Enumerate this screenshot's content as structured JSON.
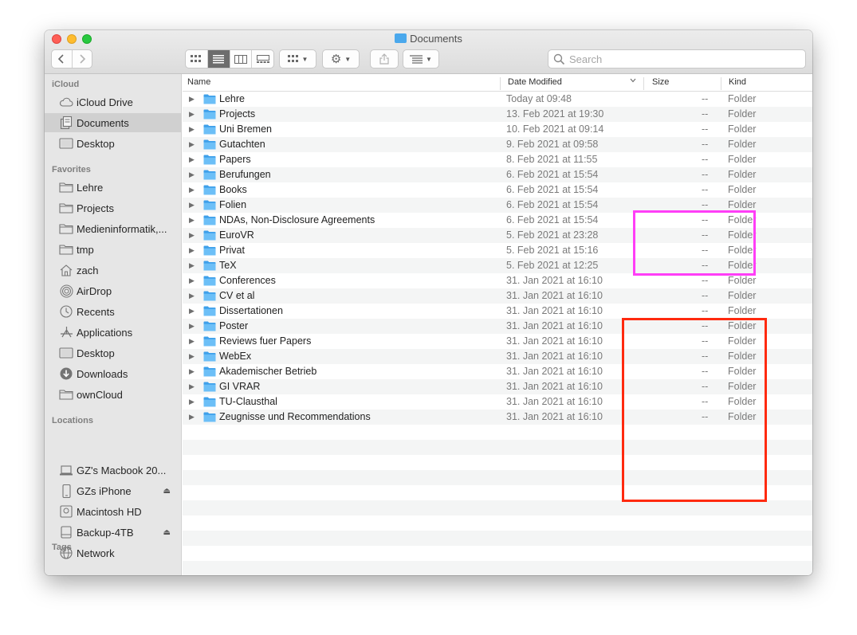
{
  "window": {
    "title": "Documents"
  },
  "toolbar": {
    "back_icon": "chevron-left",
    "forward_icon": "chevron-right",
    "search_placeholder": "Search"
  },
  "sidebar": {
    "sections": [
      {
        "title": "iCloud",
        "items": [
          {
            "label": "iCloud Drive",
            "icon": "cloud-icon"
          },
          {
            "label": "Documents",
            "icon": "document-icon",
            "selected": true
          },
          {
            "label": "Desktop",
            "icon": "desktop-icon"
          }
        ]
      },
      {
        "title": "Favorites",
        "items": [
          {
            "label": "Lehre",
            "icon": "folder-icon"
          },
          {
            "label": "Projects",
            "icon": "folder-icon"
          },
          {
            "label": "Medieninformatik,...",
            "icon": "folder-icon"
          },
          {
            "label": "tmp",
            "icon": "folder-icon"
          },
          {
            "label": "zach",
            "icon": "home-icon"
          },
          {
            "label": "AirDrop",
            "icon": "airdrop-icon"
          },
          {
            "label": "Recents",
            "icon": "clock-icon"
          },
          {
            "label": "Applications",
            "icon": "applications-icon"
          },
          {
            "label": "Desktop",
            "icon": "desktop-icon"
          },
          {
            "label": "Downloads",
            "icon": "download-icon"
          },
          {
            "label": "ownCloud",
            "icon": "folder-icon"
          }
        ]
      },
      {
        "title": "Locations",
        "items": [
          {
            "label": "GZ's Macbook 20...",
            "icon": "laptop-icon"
          },
          {
            "label": "GZs iPhone",
            "icon": "phone-icon",
            "eject": true
          },
          {
            "label": "Macintosh HD",
            "icon": "disk-icon"
          },
          {
            "label": "Backup-4TB",
            "icon": "drive-icon",
            "eject": true
          },
          {
            "label": "Network",
            "icon": "globe-icon"
          }
        ]
      },
      {
        "title": "Tags",
        "items": []
      }
    ]
  },
  "columns": {
    "name": "Name",
    "date": "Date Modified",
    "size": "Size",
    "kind": "Kind"
  },
  "files": [
    {
      "name": "Lehre",
      "date": "Today at 09:48",
      "size": "--",
      "kind": "Folder"
    },
    {
      "name": "Projects",
      "date": "13. Feb 2021 at 19:30",
      "size": "--",
      "kind": "Folder"
    },
    {
      "name": "Uni Bremen",
      "date": "10. Feb 2021 at 09:14",
      "size": "--",
      "kind": "Folder"
    },
    {
      "name": "Gutachten",
      "date": "9. Feb 2021 at 09:58",
      "size": "--",
      "kind": "Folder"
    },
    {
      "name": "Papers",
      "date": "8. Feb 2021 at 11:55",
      "size": "--",
      "kind": "Folder"
    },
    {
      "name": "Berufungen",
      "date": "6. Feb 2021 at 15:54",
      "size": "--",
      "kind": "Folder"
    },
    {
      "name": "Books",
      "date": "6. Feb 2021 at 15:54",
      "size": "--",
      "kind": "Folder"
    },
    {
      "name": "Folien",
      "date": "6. Feb 2021 at 15:54",
      "size": "--",
      "kind": "Folder"
    },
    {
      "name": "NDAs, Non-Disclosure Agreements",
      "date": "6. Feb 2021 at 15:54",
      "size": "--",
      "kind": "Folder"
    },
    {
      "name": "EuroVR",
      "date": "5. Feb 2021 at 23:28",
      "size": "--",
      "kind": "Folder"
    },
    {
      "name": "Privat",
      "date": "5. Feb 2021 at 15:16",
      "size": "--",
      "kind": "Folder"
    },
    {
      "name": "TeX",
      "date": "5. Feb 2021 at 12:25",
      "size": "--",
      "kind": "Folder"
    },
    {
      "name": "Conferences",
      "date": "31. Jan 2021 at 16:10",
      "size": "--",
      "kind": "Folder"
    },
    {
      "name": "CV et al",
      "date": "31. Jan 2021 at 16:10",
      "size": "--",
      "kind": "Folder"
    },
    {
      "name": "Dissertationen",
      "date": "31. Jan 2021 at 16:10",
      "size": "--",
      "kind": "Folder"
    },
    {
      "name": "Poster",
      "date": "31. Jan 2021 at 16:10",
      "size": "--",
      "kind": "Folder"
    },
    {
      "name": "Reviews fuer Papers",
      "date": "31. Jan 2021 at 16:10",
      "size": "--",
      "kind": "Folder"
    },
    {
      "name": "WebEx",
      "date": "31. Jan 2021 at 16:10",
      "size": "--",
      "kind": "Folder"
    },
    {
      "name": "Akademischer Betrieb",
      "date": "31. Jan 2021 at 16:10",
      "size": "--",
      "kind": "Folder"
    },
    {
      "name": "GI VRAR",
      "date": "31. Jan 2021 at 16:10",
      "size": "--",
      "kind": "Folder"
    },
    {
      "name": "TU-Clausthal",
      "date": "31. Jan 2021 at 16:10",
      "size": "--",
      "kind": "Folder"
    },
    {
      "name": "Zeugnisse und Recommendations",
      "date": "31. Jan 2021 at 16:10",
      "size": "--",
      "kind": "Folder"
    }
  ],
  "annotations": {
    "magenta": "#ff3ef7",
    "red": "#ff2a0f"
  },
  "colors": {
    "folder": "#4aa8ec",
    "selection": "#d0d0d0"
  }
}
